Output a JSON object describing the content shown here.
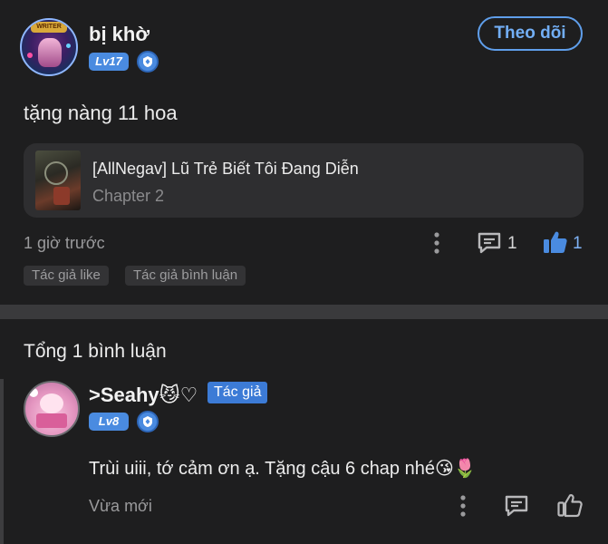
{
  "post": {
    "username": "bị khờ",
    "level": "Lv17",
    "avatar_banner": "WRITER",
    "follow_label": "Theo dõi",
    "text": "tặng nàng 11 hoa",
    "story": {
      "title": "[AllNegav] Lũ Trẻ Biết Tôi Đang Diễn",
      "chapter": "Chapter 2"
    },
    "time": "1 giờ trước",
    "comment_count": "1",
    "like_count": "1",
    "tags": [
      "Tác giả like",
      "Tác giả bình luận"
    ]
  },
  "comments_section": {
    "total_label": "Tổng 1 bình luận",
    "comments": [
      {
        "username": ">Seahy😼♡",
        "author_badge": "Tác giả",
        "level": "Lv8",
        "text": "Trùi uiii, tớ cảm ơn ạ. Tặng cậu 6 chap nhé😘🌷",
        "time": "Vừa mới"
      }
    ]
  },
  "icons": {
    "more": "more-vertical-icon",
    "comment": "comment-icon",
    "like": "thumbs-up-icon",
    "shield": "shield-icon"
  },
  "colors": {
    "background": "#1e1e1f",
    "accent_blue": "#4a8be0",
    "follow_border": "#5f9eea",
    "card": "#2e2e30",
    "muted_text": "#9a9a9c"
  }
}
